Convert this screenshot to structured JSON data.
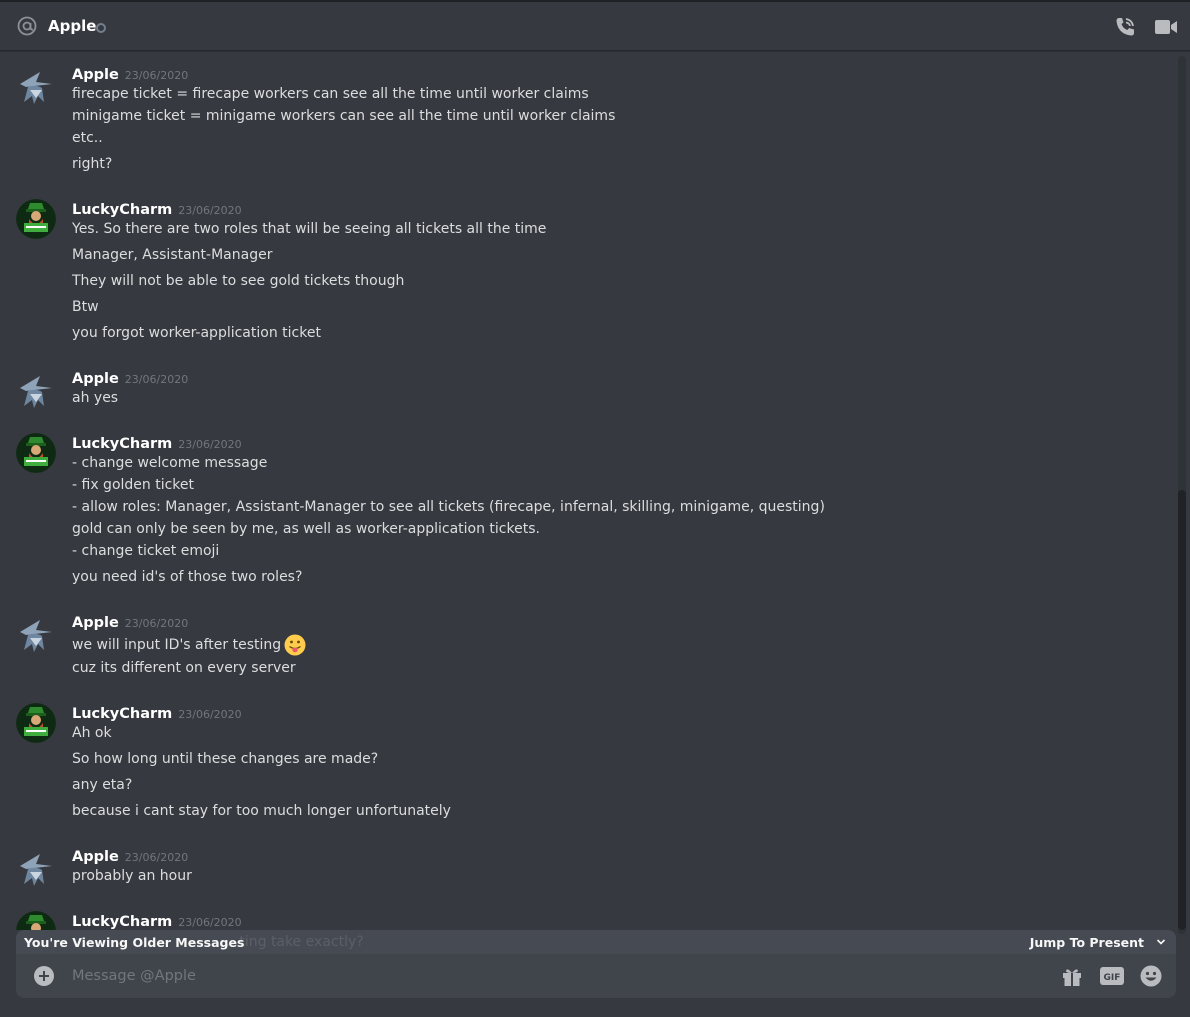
{
  "header": {
    "title": "Apple",
    "status": "offline"
  },
  "colors": {
    "background": "#36393f",
    "header_border": "#202225",
    "text": "#dcddde",
    "muted": "#72767d",
    "composer": "#40444b",
    "bar": "#474b53"
  },
  "icons": {
    "header": [
      "at-icon",
      "call-icon",
      "video-icon"
    ],
    "composer": [
      "add-icon",
      "gift-icon",
      "gif-icon",
      "emoji-icon"
    ]
  },
  "messages": [
    {
      "author": "Apple",
      "timestamp": "23/06/2020",
      "lines": [
        "firecape ticket = firecape workers can see all the time until worker claims",
        "minigame ticket = minigame workers can see all the time until worker claims",
        "etc..",
        "right?"
      ]
    },
    {
      "author": "LuckyCharm",
      "timestamp": "23/06/2020",
      "lines": [
        "Yes. So there are two roles that will be seeing all tickets all the time",
        "Manager, Assistant-Manager",
        "They will not be able to see gold tickets though",
        "Btw",
        "you forgot worker-application ticket"
      ]
    },
    {
      "author": "Apple",
      "timestamp": "23/06/2020",
      "lines": [
        "ah yes"
      ]
    },
    {
      "author": "LuckyCharm",
      "timestamp": "23/06/2020",
      "lines": [
        "- change welcome message",
        "- fix golden ticket",
        "- allow roles: Manager, Assistant-Manager to see all tickets (firecape, infernal, skilling, minigame, questing)",
        "gold can only be seen by me, as well as worker-application tickets.",
        "- change ticket emoji",
        "you need id's of those two roles?"
      ]
    },
    {
      "author": "Apple",
      "timestamp": "23/06/2020",
      "lines": [
        "we will input ID's after testing",
        "cuz its different on every server"
      ]
    },
    {
      "author": "LuckyCharm",
      "timestamp": "23/06/2020",
      "lines": [
        "Ah ok",
        "So how long until these changes are made?",
        "any eta?",
        "because i cant stay for too much longer unfortunately"
      ]
    },
    {
      "author": "Apple",
      "timestamp": "23/06/2020",
      "lines": [
        "probably an hour"
      ]
    },
    {
      "author": "LuckyCharm",
      "timestamp": "23/06/2020",
      "lines": []
    }
  ],
  "older_bar": {
    "text": "You're Viewing Older Messages",
    "partial_message": "...ting take exactly?",
    "jump_label": "Jump To Present"
  },
  "composer": {
    "placeholder": "Message @Apple"
  }
}
